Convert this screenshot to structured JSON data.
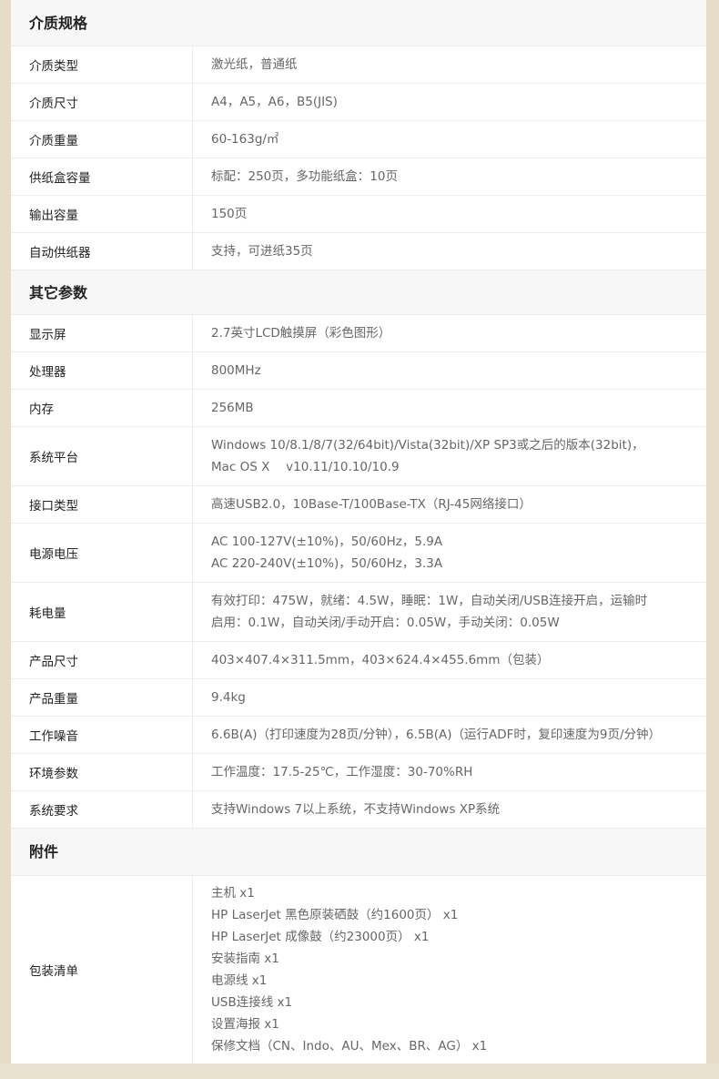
{
  "sections": [
    {
      "title": "介质规格",
      "rows": [
        {
          "label": "介质类型",
          "lines": [
            "激光纸，普通纸"
          ]
        },
        {
          "label": "介质尺寸",
          "lines": [
            "A4，A5，A6，B5(JIS)"
          ]
        },
        {
          "label": "介质重量",
          "lines": [
            "60-163g/㎡"
          ]
        },
        {
          "label": "供纸盒容量",
          "lines": [
            "标配：250页，多功能纸盒：10页"
          ]
        },
        {
          "label": "输出容量",
          "lines": [
            "150页"
          ]
        },
        {
          "label": "自动供纸器",
          "lines": [
            "支持，可进纸35页"
          ]
        }
      ]
    },
    {
      "title": "其它参数",
      "rows": [
        {
          "label": "显示屏",
          "lines": [
            "2.7英寸LCD触摸屏（彩色图形）"
          ]
        },
        {
          "label": "处理器",
          "lines": [
            "800MHz"
          ]
        },
        {
          "label": "内存",
          "lines": [
            "256MB"
          ]
        },
        {
          "label": "系统平台",
          "lines": [
            "Windows 10/8.1/8/7(32/64bit)/Vista(32bit)/XP SP3或之后的版本(32bit)，",
            "Mac OS X　 v10.11/10.10/10.9"
          ]
        },
        {
          "label": "接口类型",
          "lines": [
            "高速USB2.0，10Base-T/100Base-TX（RJ-45网络接口）"
          ]
        },
        {
          "label": "电源电压",
          "lines": [
            "AC 100-127V(±10%)，50/60Hz，5.9A",
            "AC 220-240V(±10%)，50/60Hz，3.3A"
          ]
        },
        {
          "label": "耗电量",
          "lines": [
            "有效打印：475W，就绪：4.5W，睡眠：1W，自动关闭/USB连接开启，运输时",
            "启用：0.1W，自动关闭/手动开启：0.05W，手动关闭：0.05W"
          ]
        },
        {
          "label": "产品尺寸",
          "lines": [
            "403×407.4×311.5mm，403×624.4×455.6mm（包装）"
          ]
        },
        {
          "label": "产品重量",
          "lines": [
            "9.4kg"
          ]
        },
        {
          "label": "工作噪音",
          "lines": [
            "6.6B(A)（打印速度为28页/分钟），6.5B(A)（运行ADF时，复印速度为9页/分钟）"
          ]
        },
        {
          "label": "环境参数",
          "lines": [
            "工作温度：17.5-25℃，工作湿度：30-70%RH"
          ]
        },
        {
          "label": "系统要求",
          "lines": [
            "支持Windows 7以上系统，不支持Windows XP系统"
          ]
        }
      ]
    },
    {
      "title": "附件",
      "rows": [
        {
          "label": "包装清单",
          "lines": [
            "主机  x1",
            "HP LaserJet 黑色原装硒鼓（约1600页）  x1",
            "HP LaserJet 成像鼓（约23000页）  x1",
            "安装指南  x1",
            "电源线  x1",
            "USB连接线  x1",
            "设置海报  x1",
            "保修文档（CN、Indo、AU、Mex、BR、AG）  x1"
          ]
        }
      ]
    }
  ]
}
